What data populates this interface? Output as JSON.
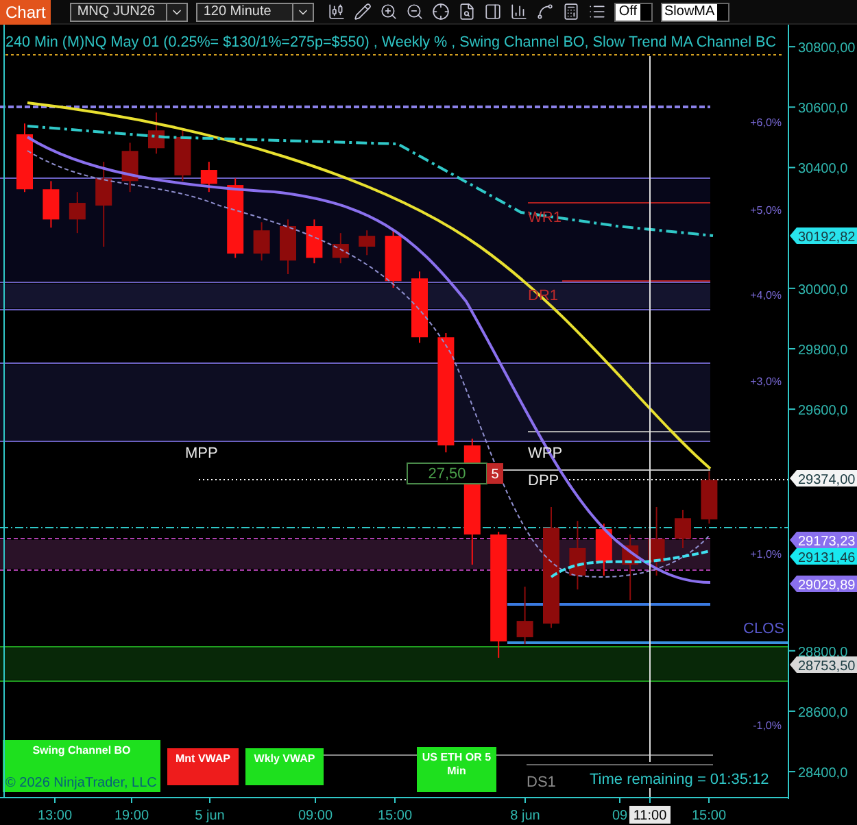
{
  "toolbar": {
    "title": "Chart",
    "instrument": "MNQ JUN26",
    "interval": "120 Minute",
    "toggles": [
      {
        "label": "Off"
      },
      {
        "label": "SlowMA"
      }
    ]
  },
  "chart": {
    "title": "240 Min (M)NQ May 01  (0.25%= $130/1%=275p=$550) , Weekly % , Swing Channel BO, Slow Trend MA Channel BC",
    "price_markers": [
      {
        "text": "30192,82",
        "color": "#29e3ec"
      },
      {
        "text": "29374,00",
        "color": "#f4f4f4"
      },
      {
        "text": "29173,23",
        "color": "#8a70ee"
      },
      {
        "text": "29131,46",
        "color": "#18e8f0"
      },
      {
        "text": "29029,89",
        "color": "#8a70ee"
      },
      {
        "text": "28753,50",
        "color": "#d8d8d8"
      }
    ],
    "percent_labels": [
      "+6,0%",
      "+5,0%",
      "+4,0%",
      "+3,0%",
      "+1,0%",
      "-1,0%"
    ],
    "level_labels": [
      {
        "text": "WR1",
        "color": "#c02a2a"
      },
      {
        "text": "DR1",
        "color": "#c02a2a"
      },
      {
        "text": "WPP",
        "color": "#e8e8e8"
      },
      {
        "text": "MPP",
        "color": "#e8e8e8"
      },
      {
        "text": "DPP",
        "color": "#e8e8e8"
      },
      {
        "text": "CLOS",
        "color": "#5a5ad0"
      },
      {
        "text": "DS1",
        "color": "#8a8a8a"
      }
    ],
    "order_marker": {
      "quantity": "27,50",
      "count": "5"
    },
    "indicator_boxes": [
      {
        "label": "Swing Channel BO",
        "color": "#1ee01e"
      },
      {
        "label": "Mnt VWAP",
        "color": "#ee1c1c"
      },
      {
        "label": "Wkly VWAP",
        "color": "#1ee01e"
      },
      {
        "label": "US ETH OR 5 Min",
        "color": "#1ee01e"
      }
    ],
    "copyright": "© 2026 NinjaTrader, LLC",
    "chart_data": {
      "type": "candlestick",
      "ylim": [
        28314,
        30873
      ],
      "yticks": [
        {
          "value": 30800,
          "label": "30800,00"
        },
        {
          "value": 30600,
          "label": "30600,0"
        },
        {
          "value": 30400,
          "label": "30400,0"
        },
        {
          "value": 30000,
          "label": "30000,0"
        },
        {
          "value": 29800,
          "label": "29800,0"
        },
        {
          "value": 29600,
          "label": "29600,0"
        },
        {
          "value": 28800,
          "label": "28800,0"
        },
        {
          "value": 28600,
          "label": "28600,0"
        },
        {
          "value": 28400,
          "label": "28400,0"
        }
      ],
      "categories": [
        null,
        null,
        null,
        null,
        null,
        null,
        null,
        null,
        null,
        null,
        null,
        null,
        null,
        null,
        null,
        null,
        null,
        null,
        null,
        null,
        null,
        null,
        null,
        null,
        null,
        null,
        null
      ],
      "ohlc": [
        [
          30510,
          30546,
          30319,
          30328
        ],
        [
          30328,
          30355,
          30201,
          30228
        ],
        [
          30228,
          30319,
          30183,
          30283
        ],
        [
          30274,
          30419,
          30138,
          30364
        ],
        [
          30355,
          30482,
          30319,
          30455
        ],
        [
          30464,
          30582,
          30446,
          30523
        ],
        [
          30374,
          30523,
          30355,
          30501
        ],
        [
          30392,
          30419,
          30319,
          30346
        ],
        [
          30342,
          30364,
          30101,
          30115
        ],
        [
          30115,
          30219,
          30092,
          30192
        ],
        [
          30092,
          30228,
          30047,
          30206
        ],
        [
          30206,
          30228,
          30083,
          30101
        ],
        [
          30101,
          30183,
          30083,
          30147
        ],
        [
          30138,
          30192,
          30110,
          30174
        ],
        [
          30174,
          30192,
          30002,
          30024
        ],
        [
          30033,
          30056,
          29820,
          29838
        ],
        [
          29838,
          29852,
          29457,
          29480
        ],
        [
          29480,
          29502,
          29085,
          29185
        ],
        [
          29185,
          29194,
          28777,
          28831
        ],
        [
          28845,
          29012,
          28822,
          28899
        ],
        [
          28890,
          29276,
          28876,
          29208
        ],
        [
          29049,
          29230,
          29003,
          29140
        ],
        [
          29203,
          29221,
          29049,
          29094
        ],
        [
          29085,
          29185,
          28967,
          29149
        ],
        [
          29094,
          29276,
          29049,
          29171
        ],
        [
          29171,
          29267,
          29140,
          29239
        ],
        [
          29235,
          29394,
          29221,
          29366
        ]
      ]
    },
    "timer": "Time remaining = 01:35:12",
    "time_labels": [
      {
        "text": "13:00",
        "selected": false
      },
      {
        "text": "19:00",
        "selected": false
      },
      {
        "text": "5 jun",
        "selected": false
      },
      {
        "text": "09:00",
        "selected": false
      },
      {
        "text": "15:00",
        "selected": false
      },
      {
        "text": "8 jun",
        "selected": false
      },
      {
        "text": "09",
        "selected": false
      },
      {
        "text": "11:00",
        "selected": true
      },
      {
        "text": "15:00",
        "selected": false
      }
    ]
  }
}
